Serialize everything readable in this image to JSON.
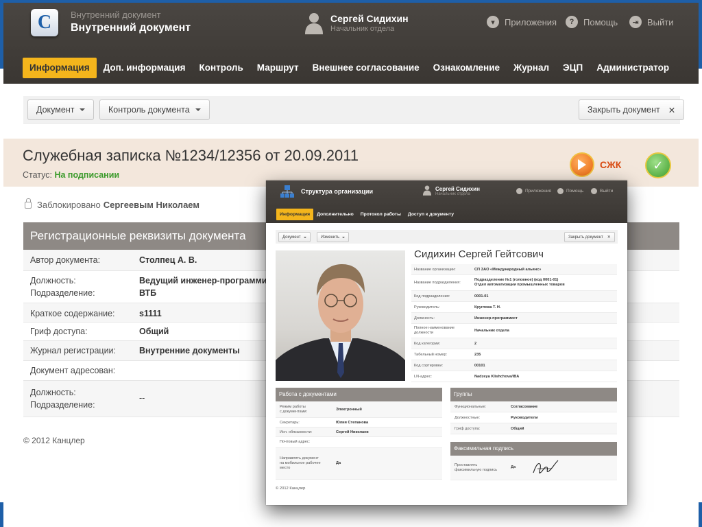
{
  "header": {
    "app_subtitle": "Внутренний документ",
    "app_title": "Внутренний документ",
    "user_name": "Сергей Сидихин",
    "user_role": "Начальник отдела",
    "links": {
      "apps": "Приложения",
      "help": "Помощь",
      "logout": "Выйти"
    }
  },
  "nav": {
    "items": [
      "Информация",
      "Доп. информация",
      "Контроль",
      "Маршрут",
      "Внешнее согласование",
      "Ознакомление",
      "Журнал",
      "ЭЦП",
      "Администратор"
    ],
    "active_index": 0
  },
  "toolbar": {
    "document": "Документ",
    "control": "Контроль документа",
    "close": "Закрыть документ"
  },
  "doc": {
    "title": "Служебная записка №1234/12356 от 20.09.2011",
    "status_label": "Статус:",
    "status_value": "На подписании",
    "sjk_label": "СЖК"
  },
  "lock": {
    "text": "Заблокировано",
    "by": "Сергеевым Николаем"
  },
  "reg": {
    "title": "Регистрационные реквизиты документа",
    "rows": [
      {
        "label": "Автор документа:",
        "value": "Столпец А. В."
      },
      {
        "label": "Должность:",
        "label2": "Подразделение:",
        "value": "Ведущий инженер-программист",
        "value2": "ВТБ"
      },
      {
        "label": "Краткое содержание:",
        "value": "s1111"
      },
      {
        "label": "Гриф доступа:",
        "value": "Общий"
      },
      {
        "label": "Журнал регистрации:",
        "value": "Внутренние документы"
      },
      {
        "label": "Документ адресован:",
        "value": ""
      },
      {
        "label": "Должность:",
        "label2": "Подразделение:",
        "value": "--"
      }
    ]
  },
  "footer": {
    "copyright": "© 2012 Канцлер"
  },
  "overlay": {
    "title": "Структура организации",
    "user_name": "Сергей Сидихин",
    "user_role": "Начальник отдела",
    "links": {
      "apps": "Приложения",
      "help": "Помощь",
      "logout": "Выйти"
    },
    "nav": [
      "Информация",
      "Дополнительно",
      "Протокол работы",
      "Доступ к документу"
    ],
    "toolbar": {
      "document": "Документ",
      "change": "Изменить",
      "close": "Закрыть документ"
    },
    "person_name": "Сидихин Сергей Гейтсович",
    "profile_rows": [
      {
        "label": "Название организации:",
        "value": "СП ЗАО «Международный альянс»"
      },
      {
        "label": "Название подразделения:",
        "value": "Подразделение №1 (головное) (код 0001-01)",
        "value2": "Отдел автоматизации промышленных товаров"
      },
      {
        "label": "Код подразделения:",
        "value": "0001-01"
      },
      {
        "label": "Руководитель:",
        "value": "Круглова Т. Н."
      },
      {
        "label": "Должность:",
        "value": "Инженер-программист"
      },
      {
        "label": "Полное наименование",
        "label2": "должности",
        "value": "Начальник отдела"
      },
      {
        "label": "Код категории:",
        "value": "2"
      },
      {
        "label": "Табельный номер:",
        "value": "235"
      },
      {
        "label": "Код сортировки:",
        "value": "00101"
      },
      {
        "label": "LN-адрес:",
        "value": "Nadzeya Klishchova/IBA"
      }
    ],
    "work": {
      "title": "Работа с документами",
      "rows": [
        {
          "label": "Режим работы",
          "label2": "с документами:",
          "value": "Электронный"
        },
        {
          "label": "Секретарь:",
          "value": "Юлия Степанова"
        },
        {
          "label": "Исп. обязанности:",
          "value": "Сергей Николаев"
        },
        {
          "label": "Почтовый адрес:",
          "value": ""
        },
        {
          "label": "Направлять документ",
          "label2": "на мобильное рабочее",
          "label3": "место",
          "value": "Да"
        }
      ]
    },
    "groups": {
      "title": "Группы",
      "rows": [
        {
          "label": "Функциональные:",
          "value": "Согласование"
        },
        {
          "label": "Должностные:",
          "value": "Руководители"
        },
        {
          "label": "Гриф доступа:",
          "value": "Общий"
        }
      ]
    },
    "fax": {
      "title": "Факсимильная подпись",
      "label": "Проставлять",
      "label2": "факсимильную подпись",
      "value": "Да"
    },
    "copyright": "© 2012 Канцлер"
  }
}
